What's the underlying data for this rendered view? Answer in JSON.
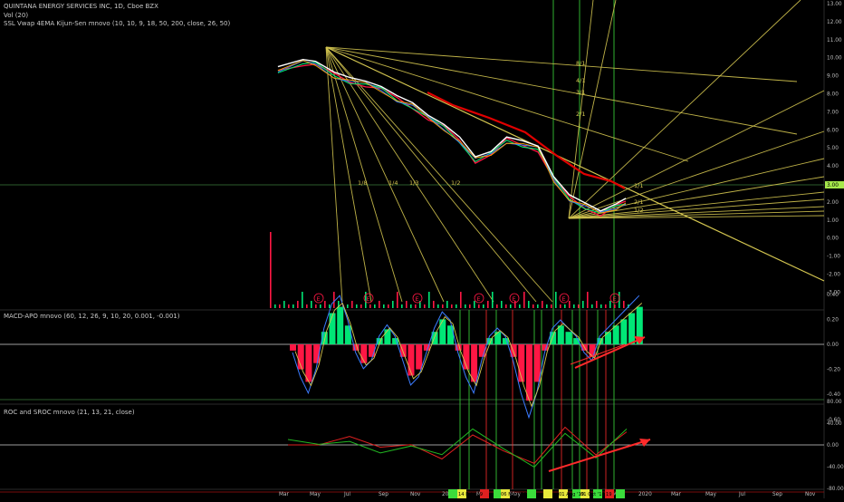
{
  "header": {
    "title": "QUINTANA ENERGY SERVICES INC, 1D, Cboe BZX",
    "vol": "Vol (20)",
    "ssl": "SSL Vwap 4EMA Kijun-Sen mnovo (10, 10, 9, 18, 50, 200, close, 26, 50)"
  },
  "macd": {
    "title": "MACD-APO mnovo (60, 12, 26, 9, 10, 20, 0.001, -0.001)"
  },
  "roc": {
    "title": "ROC and SROC mnovo (21, 13, 21, close)"
  },
  "colors": {
    "background": "#000000",
    "up": "#00e676",
    "down": "#ff1744",
    "fan": "#d4c650",
    "ma_red": "#e00000",
    "ma_white": "#ffffff",
    "price_tag": "#a6e84b",
    "arrow": "#ff2b2b"
  },
  "chart_data": [
    {
      "type": "line",
      "panel": "price",
      "y_axis": [
        "13.00",
        "12.00",
        "11.00",
        "10.00",
        "9.00",
        "8.00",
        "7.00",
        "6.00",
        "5.00",
        "4.00",
        "3.00",
        "2.00",
        "1.00",
        "0.00",
        "-1.00",
        "-2.00",
        "-3.00"
      ],
      "ylim": [
        -3.8,
        13.5
      ],
      "x_labels": [
        "Mar",
        "May",
        "Jul",
        "Sep",
        "Nov",
        "2019",
        "Mar",
        "May",
        "Jul",
        "Sep",
        "Nov",
        "2020",
        "Mar",
        "May",
        "Jul",
        "Sep",
        "Nov"
      ],
      "current_price": "3.00",
      "series": [
        {
          "x": [
            0.2,
            1,
            1.4,
            2,
            2.5,
            3,
            3.5,
            4,
            4.5,
            5,
            5.5,
            6,
            6.5,
            7,
            7.5,
            8,
            8.5,
            9,
            9.5,
            10,
            10.5,
            11,
            11.3
          ],
          "values": [
            9.3,
            9.7,
            9.6,
            9.0,
            8.7,
            8.5,
            8.2,
            7.7,
            7.3,
            6.6,
            6.1,
            5.4,
            4.3,
            4.6,
            5.4,
            5.2,
            4.9,
            3.2,
            2.2,
            1.75,
            1.3,
            1.7,
            2.0
          ]
        }
      ],
      "fan_labels": [
        "1/8",
        "1/4",
        "1/3",
        "1/2",
        "8/1",
        "4/1",
        "3/1",
        "2/1",
        "1/1",
        "2/1",
        "1/2"
      ],
      "earnings_markers": [
        "E",
        "E",
        "E",
        "E",
        "E",
        "E",
        "E"
      ]
    },
    {
      "type": "bar",
      "panel": "macd",
      "y_axis": [
        "0.40",
        "0.20",
        "0.00",
        "-0.20",
        "-0.40",
        "-0.60"
      ],
      "ylim": [
        -0.72,
        0.42
      ],
      "values": [
        -0.05,
        -0.2,
        -0.3,
        -0.15,
        0.1,
        0.25,
        0.3,
        0.15,
        -0.05,
        -0.15,
        -0.1,
        0.05,
        0.12,
        0.05,
        -0.1,
        -0.25,
        -0.2,
        -0.05,
        0.1,
        0.2,
        0.15,
        -0.05,
        -0.2,
        -0.3,
        -0.1,
        0.05,
        0.1,
        0.05,
        -0.1,
        -0.3,
        -0.45,
        -0.3,
        -0.05,
        0.1,
        0.15,
        0.1,
        0.05,
        -0.05,
        -0.1,
        0.05,
        0.1,
        0.15,
        0.2,
        0.25,
        0.3
      ]
    },
    {
      "type": "line",
      "panel": "roc",
      "y_axis": [
        "80.00",
        "40.00",
        "0.00",
        "-40.00",
        "-80.00"
      ],
      "ylim": [
        -95,
        100
      ],
      "x": [
        0,
        1,
        2,
        3,
        4,
        5,
        6,
        7,
        8,
        9,
        10,
        11
      ],
      "values": [
        0,
        -5,
        10,
        -5,
        5,
        -20,
        20,
        -15,
        -40,
        30,
        -15,
        30
      ]
    }
  ],
  "date_labels": [
    "14 Feb '19",
    "06 May '19",
    "01 Aug '19",
    "01 Oct '19",
    "19"
  ]
}
